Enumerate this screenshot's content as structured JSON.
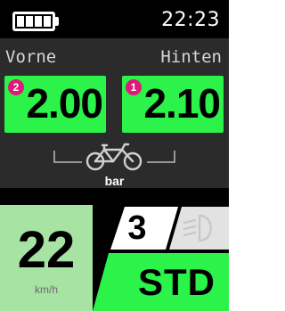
{
  "status": {
    "time": "22:23",
    "battery_icon": "battery-full-icon",
    "battery_level": 1.0
  },
  "tire_pressure": {
    "front": {
      "label": "Vorne",
      "value": "2.00",
      "badge": "2"
    },
    "rear": {
      "label": "Hinten",
      "value": "2.10",
      "badge": "1"
    },
    "unit": "bar",
    "icon": "bicycle-icon"
  },
  "ride": {
    "speed": "22",
    "speed_unit": "km/h",
    "gear": "3",
    "mode": "STD",
    "light_icon": "headlight-icon"
  },
  "colors": {
    "background": "#000000",
    "panel": "#2b2b2b",
    "pressure_ok": "#2bf34a",
    "speed_bg": "#a7e3a2",
    "badge": "#e0187a",
    "mode_bg": "#2bf34a"
  }
}
